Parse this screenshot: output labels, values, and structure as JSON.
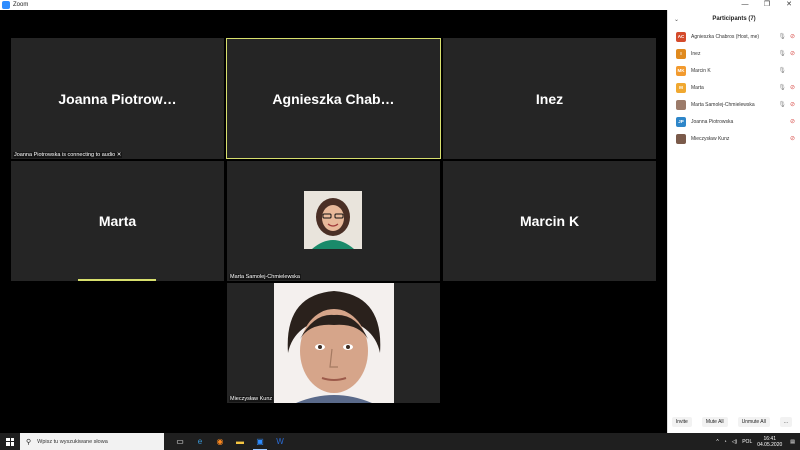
{
  "window": {
    "title": "Zoom",
    "minimize": "—",
    "restore": "❐",
    "close": "✕"
  },
  "tiles": {
    "joanna": {
      "name": "Joanna  Piotrow…",
      "caption": "Joanna Piotrowska is connecting to audio ✕"
    },
    "agnieszka": {
      "name": "Agnieszka  Chab…"
    },
    "inez": {
      "name": "Inez"
    },
    "marta": {
      "name": "Marta"
    },
    "marta_s": {
      "caption": "Marta Samolej-Chmielewska"
    },
    "marcin": {
      "name": "Marcin K"
    },
    "mieczyslaw": {
      "caption": "Mieczysław Kunz"
    }
  },
  "participants": {
    "title": "Participants (7)",
    "items": [
      {
        "initials": "AC",
        "name": "Agnieszka Chabros (Host, me)",
        "color": "#d44b2c",
        "mic": "🎙",
        "cam": "⊘"
      },
      {
        "initials": "I",
        "name": "Inez",
        "color": "#e08a1e",
        "mic": "🎙",
        "cam": "⊘"
      },
      {
        "initials": "MK",
        "name": "Marcin K",
        "color": "#f29a2e",
        "mic": "🎙",
        "cam": ""
      },
      {
        "initials": "M",
        "name": "Marta",
        "color": "#f0a830",
        "mic": "🎙",
        "cam": "⊘"
      },
      {
        "initials": "",
        "name": "Marta Samolej-Chmielewska",
        "color": "#9c7b6a",
        "mic": "🎙",
        "cam": "⊘"
      },
      {
        "initials": "JP",
        "name": "Joanna Piotrowska",
        "color": "#2e86c9",
        "mic": "",
        "cam": "⊘"
      },
      {
        "initials": "",
        "name": "Mieczysław Kunz",
        "color": "#7a5a4a",
        "mic": "",
        "cam": "⊘"
      }
    ],
    "invite": "Invite",
    "mute_all": "Mute All",
    "unmute_all": "Unmute All",
    "more": "..."
  },
  "taskbar": {
    "search_placeholder": "Wpisz tu wyszukiwane słowa",
    "lang": "POL",
    "time": "16:41",
    "date": "04.05.2020"
  }
}
